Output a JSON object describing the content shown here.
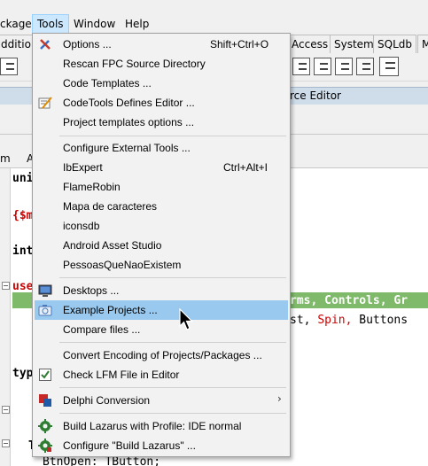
{
  "menubar": {
    "items": [
      {
        "label": "ckage"
      },
      {
        "label": "Tools"
      },
      {
        "label": "Window"
      },
      {
        "label": "Help"
      }
    ]
  },
  "palette": {
    "tabs": [
      {
        "label": "ddition"
      },
      {
        "label": "Access"
      },
      {
        "label": "System"
      },
      {
        "label": "SQLdb"
      },
      {
        "label": "M"
      }
    ]
  },
  "editor": {
    "title_fragment": "rce Editor",
    "tab_fragments": [
      "m",
      "A"
    ],
    "lines": {
      "uni": "uni",
      "dir": "{$m",
      "int": "int",
      "use": "use",
      "hl_text": "rms, Controls, Gr",
      "line2_a": "st, ",
      "line2_b": "Spin",
      "line2_c": ", ",
      "line2_d": "Buttons",
      "typ": "typ",
      "T": "T",
      "last": "BtnOpen: TButton;"
    }
  },
  "tools_menu": {
    "items": [
      {
        "label": "Options ...",
        "shortcut": "Shift+Ctrl+O",
        "icon": "wrench-screwdriver-icon"
      },
      {
        "label": "Rescan FPC Source Directory",
        "shortcut": "",
        "icon": ""
      },
      {
        "label": "Code Templates ...",
        "shortcut": "",
        "icon": ""
      },
      {
        "label": "CodeTools Defines Editor ...",
        "shortcut": "",
        "icon": "codetools-editor-icon"
      },
      {
        "label": "Project templates options ...",
        "shortcut": "",
        "icon": ""
      },
      {
        "label": "Configure External Tools ...",
        "shortcut": "",
        "icon": ""
      },
      {
        "label": "IbExpert",
        "shortcut": "Ctrl+Alt+I",
        "icon": ""
      },
      {
        "label": "FlameRobin",
        "shortcut": "",
        "icon": ""
      },
      {
        "label": "Mapa de caracteres",
        "shortcut": "",
        "icon": ""
      },
      {
        "label": "iconsdb",
        "shortcut": "",
        "icon": ""
      },
      {
        "label": "Android Asset Studio",
        "shortcut": "",
        "icon": ""
      },
      {
        "label": "PessoasQueNaoExistem",
        "shortcut": "",
        "icon": ""
      },
      {
        "label": "Desktops ...",
        "shortcut": "",
        "icon": "monitor-icon"
      },
      {
        "label": "Example Projects ...",
        "shortcut": "",
        "icon": "camera-icon"
      },
      {
        "label": "Compare files ...",
        "shortcut": "",
        "icon": ""
      },
      {
        "label": "Convert Encoding of Projects/Packages ...",
        "shortcut": "",
        "icon": ""
      },
      {
        "label": "Check LFM File in Editor",
        "shortcut": "",
        "icon": "checkbox-icon"
      },
      {
        "label": "Delphi Conversion",
        "shortcut": "",
        "icon": "delphi-conversion-icon",
        "submenu_arrow": "›"
      },
      {
        "label": "Build Lazarus with Profile: IDE normal",
        "shortcut": "",
        "icon": "gear-icon"
      },
      {
        "label": "Configure \"Build Lazarus\" ...",
        "shortcut": "",
        "icon": "gear-icon"
      }
    ]
  },
  "colors": {
    "menu_hover": "#99c9ef",
    "menubar_active": "#cce8ff",
    "code_directive": "#d00000",
    "code_highlight": "#7fba6a"
  }
}
